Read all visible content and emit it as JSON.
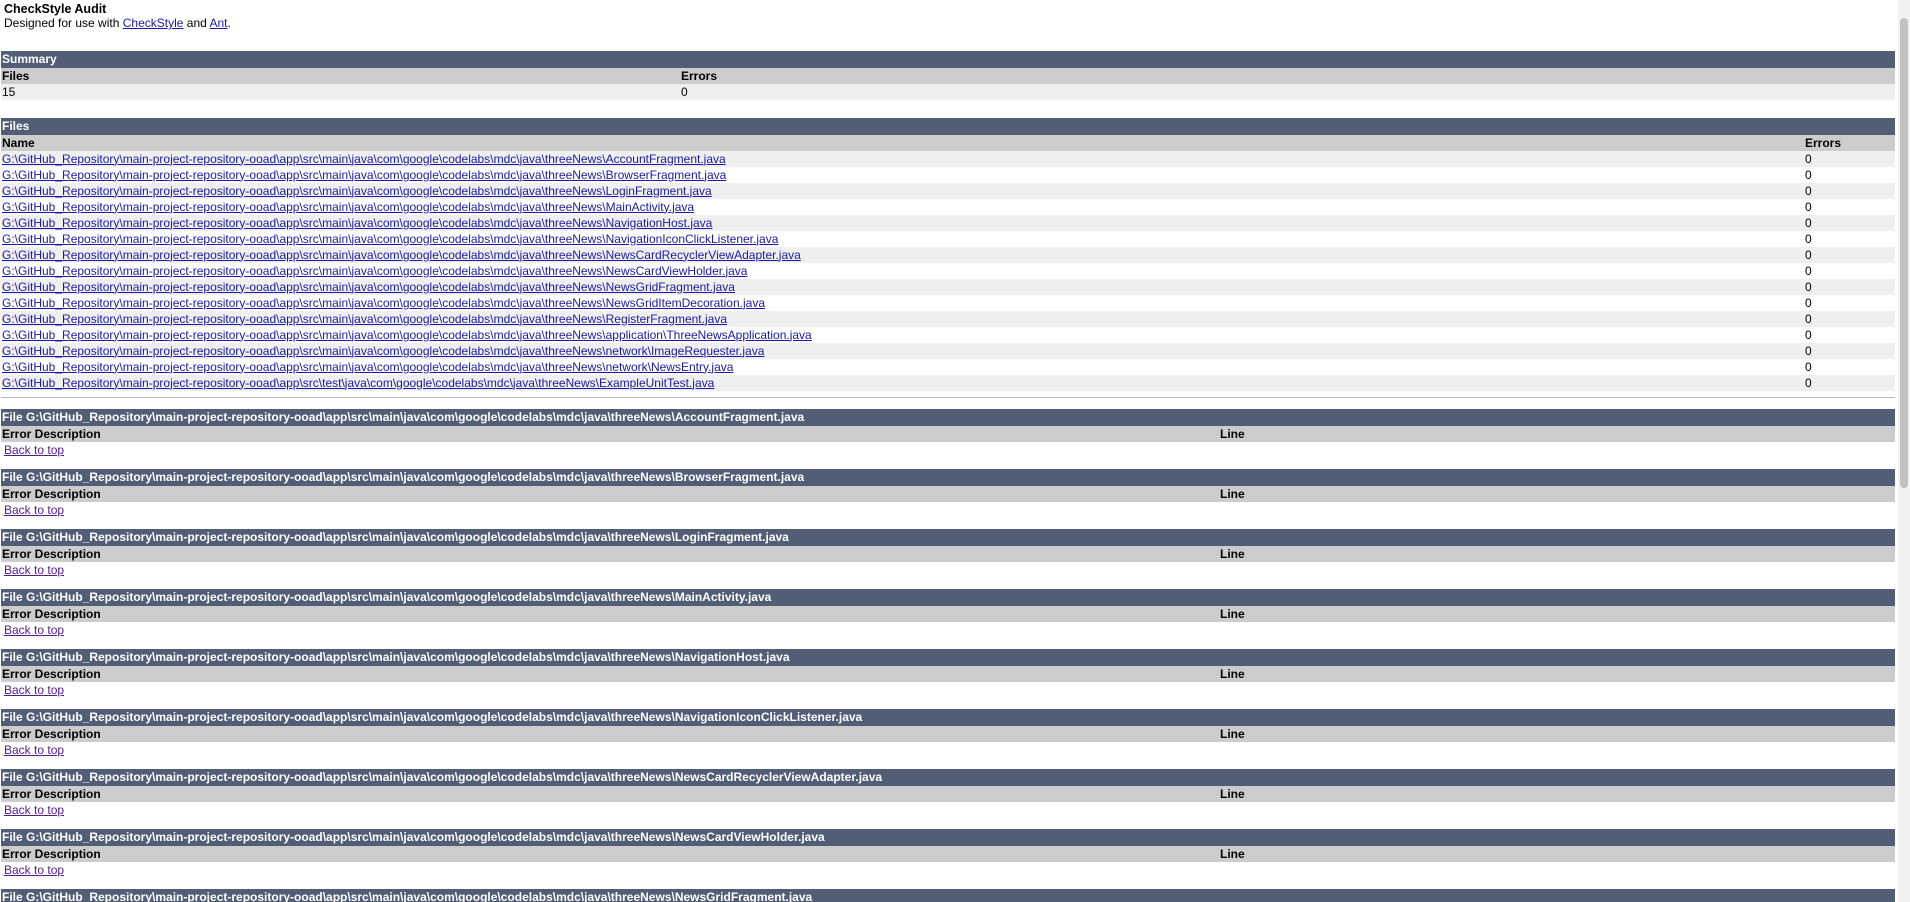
{
  "header": {
    "title": "CheckStyle Audit",
    "subtitle_prefix": "Designed for use with ",
    "checkstyle_link": "CheckStyle",
    "and_text": " and ",
    "ant_link": "Ant",
    "period": "."
  },
  "summary": {
    "heading": "Summary",
    "col_files": "Files",
    "col_errors": "Errors",
    "files_value": "15",
    "errors_value": "0"
  },
  "files": {
    "heading": "Files",
    "col_name": "Name",
    "col_errors": "Errors",
    "rows": [
      {
        "name": "G:\\GitHub_Repository\\main-project-repository-ooad\\app\\src\\main\\java\\com\\google\\codelabs\\mdc\\java\\threeNews\\AccountFragment.java",
        "errors": "0"
      },
      {
        "name": "G:\\GitHub_Repository\\main-project-repository-ooad\\app\\src\\main\\java\\com\\google\\codelabs\\mdc\\java\\threeNews\\BrowserFragment.java",
        "errors": "0"
      },
      {
        "name": "G:\\GitHub_Repository\\main-project-repository-ooad\\app\\src\\main\\java\\com\\google\\codelabs\\mdc\\java\\threeNews\\LoginFragment.java",
        "errors": "0"
      },
      {
        "name": "G:\\GitHub_Repository\\main-project-repository-ooad\\app\\src\\main\\java\\com\\google\\codelabs\\mdc\\java\\threeNews\\MainActivity.java",
        "errors": "0"
      },
      {
        "name": "G:\\GitHub_Repository\\main-project-repository-ooad\\app\\src\\main\\java\\com\\google\\codelabs\\mdc\\java\\threeNews\\NavigationHost.java",
        "errors": "0"
      },
      {
        "name": "G:\\GitHub_Repository\\main-project-repository-ooad\\app\\src\\main\\java\\com\\google\\codelabs\\mdc\\java\\threeNews\\NavigationIconClickListener.java",
        "errors": "0"
      },
      {
        "name": "G:\\GitHub_Repository\\main-project-repository-ooad\\app\\src\\main\\java\\com\\google\\codelabs\\mdc\\java\\threeNews\\NewsCardRecyclerViewAdapter.java",
        "errors": "0"
      },
      {
        "name": "G:\\GitHub_Repository\\main-project-repository-ooad\\app\\src\\main\\java\\com\\google\\codelabs\\mdc\\java\\threeNews\\NewsCardViewHolder.java",
        "errors": "0"
      },
      {
        "name": "G:\\GitHub_Repository\\main-project-repository-ooad\\app\\src\\main\\java\\com\\google\\codelabs\\mdc\\java\\threeNews\\NewsGridFragment.java",
        "errors": "0"
      },
      {
        "name": "G:\\GitHub_Repository\\main-project-repository-ooad\\app\\src\\main\\java\\com\\google\\codelabs\\mdc\\java\\threeNews\\NewsGridItemDecoration.java",
        "errors": "0"
      },
      {
        "name": "G:\\GitHub_Repository\\main-project-repository-ooad\\app\\src\\main\\java\\com\\google\\codelabs\\mdc\\java\\threeNews\\RegisterFragment.java",
        "errors": "0"
      },
      {
        "name": "G:\\GitHub_Repository\\main-project-repository-ooad\\app\\src\\main\\java\\com\\google\\codelabs\\mdc\\java\\threeNews\\application\\ThreeNewsApplication.java",
        "errors": "0"
      },
      {
        "name": "G:\\GitHub_Repository\\main-project-repository-ooad\\app\\src\\main\\java\\com\\google\\codelabs\\mdc\\java\\threeNews\\network\\ImageRequester.java",
        "errors": "0"
      },
      {
        "name": "G:\\GitHub_Repository\\main-project-repository-ooad\\app\\src\\main\\java\\com\\google\\codelabs\\mdc\\java\\threeNews\\network\\NewsEntry.java",
        "errors": "0"
      },
      {
        "name": "G:\\GitHub_Repository\\main-project-repository-ooad\\app\\src\\test\\java\\com\\google\\codelabs\\mdc\\java\\threeNews\\ExampleUnitTest.java",
        "errors": "0"
      }
    ]
  },
  "file_sections": {
    "col_error_description": "Error Description",
    "col_line": "Line",
    "back_to_top": "Back to top",
    "items": [
      {
        "title": "File G:\\GitHub_Repository\\main-project-repository-ooad\\app\\src\\main\\java\\com\\google\\codelabs\\mdc\\java\\threeNews\\AccountFragment.java"
      },
      {
        "title": "File G:\\GitHub_Repository\\main-project-repository-ooad\\app\\src\\main\\java\\com\\google\\codelabs\\mdc\\java\\threeNews\\BrowserFragment.java"
      },
      {
        "title": "File G:\\GitHub_Repository\\main-project-repository-ooad\\app\\src\\main\\java\\com\\google\\codelabs\\mdc\\java\\threeNews\\LoginFragment.java"
      },
      {
        "title": "File G:\\GitHub_Repository\\main-project-repository-ooad\\app\\src\\main\\java\\com\\google\\codelabs\\mdc\\java\\threeNews\\MainActivity.java"
      },
      {
        "title": "File G:\\GitHub_Repository\\main-project-repository-ooad\\app\\src\\main\\java\\com\\google\\codelabs\\mdc\\java\\threeNews\\NavigationHost.java"
      },
      {
        "title": "File G:\\GitHub_Repository\\main-project-repository-ooad\\app\\src\\main\\java\\com\\google\\codelabs\\mdc\\java\\threeNews\\NavigationIconClickListener.java"
      },
      {
        "title": "File G:\\GitHub_Repository\\main-project-repository-ooad\\app\\src\\main\\java\\com\\google\\codelabs\\mdc\\java\\threeNews\\NewsCardRecyclerViewAdapter.java"
      },
      {
        "title": "File G:\\GitHub_Repository\\main-project-repository-ooad\\app\\src\\main\\java\\com\\google\\codelabs\\mdc\\java\\threeNews\\NewsCardViewHolder.java"
      },
      {
        "title": "File G:\\GitHub_Repository\\main-project-repository-ooad\\app\\src\\main\\java\\com\\google\\codelabs\\mdc\\java\\threeNews\\NewsGridFragment.java"
      }
    ]
  },
  "colors": {
    "header_bg": "#525d76",
    "column_header_bg": "#cccccc",
    "row_alt_bg": "#efefef",
    "link": "#1a1aa6",
    "visited_link": "#551a8b"
  }
}
